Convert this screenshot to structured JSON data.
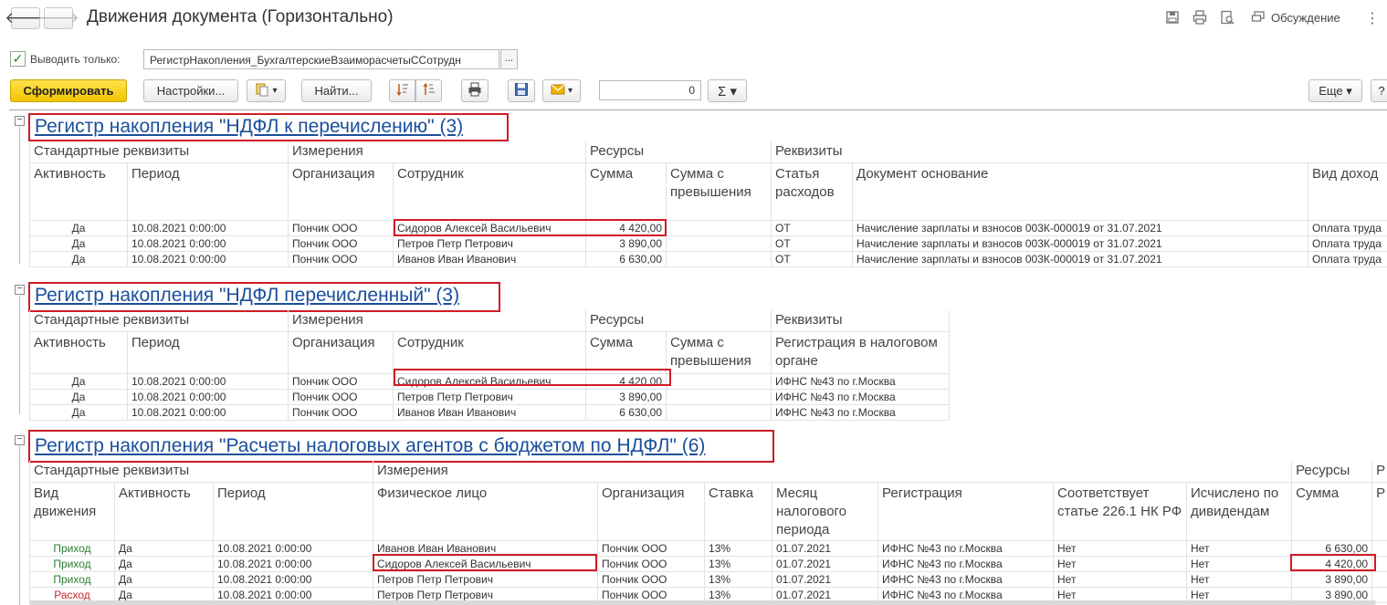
{
  "window": {
    "title": "Движения документа (Горизонтально)",
    "back_glyph": "🡐",
    "forward_glyph": "🡒",
    "discussion_label": "Обсуждение",
    "more_glyph": "⋮"
  },
  "filter": {
    "checked_glyph": "✓",
    "only_label": "Выводить только:",
    "register_value": "РегистрНакопления_БухгалтерскиеВзаиморасчетыССотрудн",
    "dots_label": "..."
  },
  "toolbar": {
    "generate_label": "Сформировать",
    "settings_label": "Настройки...",
    "find_label": "Найти...",
    "sum_value": "0",
    "sigma_label": "Σ ▾",
    "more_label": "Еще ▾",
    "help_label": "?",
    "dropdown_glyph": "▾"
  },
  "icons": {
    "back": "arrow-left-icon",
    "forward": "arrow-right-icon",
    "save": "save-icon",
    "print": "print-icon",
    "preview": "preview-icon",
    "chat": "chat-icon",
    "copy": "copy-icon",
    "sort_asc": "sort-ascending-icon",
    "sort_desc": "sort-descending-icon",
    "mail": "mail-icon",
    "collapse": "collapse-icon"
  },
  "colors": {
    "accent_yellow": "#f5c800",
    "highlight_red": "#d11b24",
    "link_blue": "#1a4f9c",
    "income_green": "#2d7d2d",
    "expense_red": "#c8262c"
  },
  "sections": [
    {
      "title": "Регистр накопления \"НДФЛ к перечислению\" (3)",
      "groups": [
        "Стандартные реквизиты",
        "Измерения",
        "Ресурсы",
        "Реквизиты"
      ],
      "columns": [
        "Активность",
        "Период",
        "Организация",
        "Сотрудник",
        "Сумма",
        "Сумма с превышения",
        "Статья расходов",
        "Документ основание",
        "Вид доход"
      ],
      "rows": [
        [
          "Да",
          "10.08.2021 0:00:00",
          "Пончик ООО",
          "Сидоров Алексей Васильевич",
          "4 420,00",
          "",
          "ОТ",
          "Начисление зарплаты и взносов 003К-000019 от 31.07.2021",
          "Оплата труда"
        ],
        [
          "Да",
          "10.08.2021 0:00:00",
          "Пончик ООО",
          "Петров Петр Петрович",
          "3 890,00",
          "",
          "ОТ",
          "Начисление зарплаты и взносов 003К-000019 от 31.07.2021",
          "Оплата труда"
        ],
        [
          "Да",
          "10.08.2021 0:00:00",
          "Пончик ООО",
          "Иванов Иван Иванович",
          "6 630,00",
          "",
          "ОТ",
          "Начисление зарплаты и взносов 003К-000019 от 31.07.2021",
          "Оплата труда"
        ]
      ]
    },
    {
      "title": "Регистр накопления \"НДФЛ перечисленный\" (3)",
      "groups": [
        "Стандартные реквизиты",
        "Измерения",
        "Ресурсы",
        "Реквизиты"
      ],
      "columns": [
        "Активность",
        "Период",
        "Организация",
        "Сотрудник",
        "Сумма",
        "Сумма с превышения",
        "Регистрация в налоговом органе"
      ],
      "rows": [
        [
          "Да",
          "10.08.2021 0:00:00",
          "Пончик ООО",
          "Сидоров Алексей Васильевич",
          "4 420,00",
          "",
          "ИФНС №43 по г.Москва"
        ],
        [
          "Да",
          "10.08.2021 0:00:00",
          "Пончик ООО",
          "Петров Петр Петрович",
          "3 890,00",
          "",
          "ИФНС №43 по г.Москва"
        ],
        [
          "Да",
          "10.08.2021 0:00:00",
          "Пончик ООО",
          "Иванов Иван Иванович",
          "6 630,00",
          "",
          "ИФНС №43 по г.Москва"
        ]
      ]
    },
    {
      "title": "Регистр накопления \"Расчеты налоговых агентов с бюджетом по НДФЛ\" (6)",
      "groups": [
        "Стандартные реквизиты",
        "Измерения",
        "Ресурсы",
        "Р"
      ],
      "columns": [
        "Вид движения",
        "Активность",
        "Период",
        "Физическое лицо",
        "Организация",
        "Ставка",
        "Месяц налогового периода",
        "Регистрация",
        "Соответствует статье 226.1 НК РФ",
        "Исчислено по дивидендам",
        "Сумма",
        "Р п"
      ],
      "rows": [
        [
          "Приход",
          "Да",
          "10.08.2021 0:00:00",
          "Иванов Иван Иванович",
          "Пончик ООО",
          "13%",
          "01.07.2021",
          "ИФНС №43 по г.Москва",
          "Нет",
          "Нет",
          "6 630,00",
          ""
        ],
        [
          "Приход",
          "Да",
          "10.08.2021 0:00:00",
          "Сидоров Алексей Васильевич",
          "Пончик ООО",
          "13%",
          "01.07.2021",
          "ИФНС №43 по г.Москва",
          "Нет",
          "Нет",
          "4 420,00",
          ""
        ],
        [
          "Приход",
          "Да",
          "10.08.2021 0:00:00",
          "Петров Петр Петрович",
          "Пончик ООО",
          "13%",
          "01.07.2021",
          "ИФНС №43 по г.Москва",
          "Нет",
          "Нет",
          "3 890,00",
          ""
        ],
        [
          "Расход",
          "Да",
          "10.08.2021 0:00:00",
          "Петров Петр Петрович",
          "Пончик ООО",
          "13%",
          "01.07.2021",
          "ИФНС №43 по г.Москва",
          "Нет",
          "Нет",
          "3 890,00",
          ""
        ]
      ]
    }
  ]
}
